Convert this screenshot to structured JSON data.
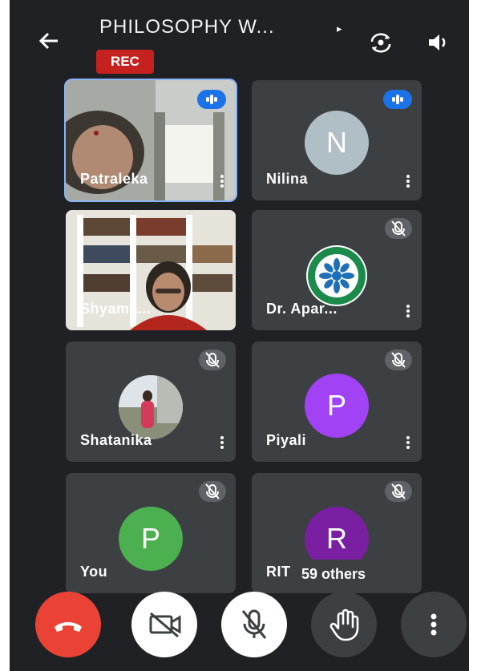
{
  "header": {
    "title": "PHILOSOPHY W...",
    "rec_label": "REC",
    "icons": [
      "back-arrow-icon",
      "caret-right-icon",
      "switch-camera-icon",
      "speaker-icon"
    ]
  },
  "participants": [
    {
      "name": "Patraleka",
      "display_name": "Patraleka",
      "state": "speaking",
      "media": "camera"
    },
    {
      "name": "Nilina",
      "display_name": "Nilina",
      "initial": "N",
      "avatar_color": "#b0bec5",
      "state": "speaking"
    },
    {
      "name": "Shyama...",
      "display_name": "Shyama...",
      "state": "camera"
    },
    {
      "name": "Dr. Apar...",
      "display_name": "Dr. Apar...",
      "state": "muted",
      "media": "logo"
    },
    {
      "name": "Shatanika",
      "display_name": "Shatanika",
      "state": "muted",
      "media": "photo"
    },
    {
      "name": "Piyali",
      "display_name": "Piyali",
      "initial": "P",
      "avatar_color": "#a142f4",
      "state": "muted"
    },
    {
      "name": "You",
      "display_name": "You",
      "initial": "P",
      "avatar_color": "#4caf50",
      "state": "muted"
    },
    {
      "name": "RITA",
      "display_name": "RIT",
      "initial": "R",
      "avatar_color": "#7b1fa2",
      "state": "muted"
    }
  ],
  "others_label": "59 others",
  "controls": [
    {
      "name": "end-call",
      "color": "#ea4335",
      "icon": "phone-hangup-icon"
    },
    {
      "name": "camera-off",
      "color": "#ffffff",
      "icon": "video-off-icon"
    },
    {
      "name": "mic-off",
      "color": "#ffffff",
      "icon": "mic-off-icon"
    },
    {
      "name": "raise-hand",
      "color": "#3c4043",
      "icon": "hand-icon"
    },
    {
      "name": "more-options",
      "color": "#3c4043",
      "icon": "more-vert-icon"
    }
  ],
  "colors": {
    "background": "#202124",
    "tile": "#3c4043",
    "accent": "#1a73e8",
    "rec": "#c5221f",
    "active_outline": "#8ab4f8"
  }
}
